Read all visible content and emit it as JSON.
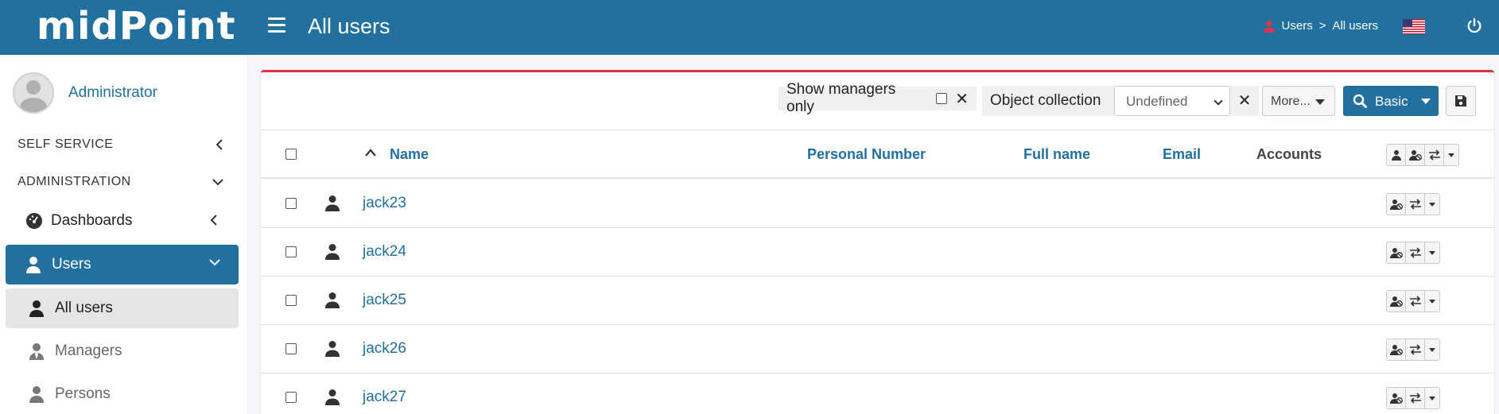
{
  "header": {
    "logo_text": "midPoint",
    "page_title": "All users",
    "breadcrumbs": [
      "Users",
      ">",
      "All users"
    ]
  },
  "sidebar": {
    "profile_name": "Administrator",
    "sections": [
      {
        "label": "SELF SERVICE"
      },
      {
        "label": "ADMINISTRATION"
      }
    ],
    "items": [
      {
        "label": "Dashboards"
      },
      {
        "label": "Users"
      },
      {
        "label": "All users"
      },
      {
        "label": "Managers"
      },
      {
        "label": "Persons"
      }
    ]
  },
  "toolbar": {
    "show_managers_label": "Show managers only",
    "object_collection_label": "Object collection",
    "object_collection_value": "Undefined",
    "more_label": "More...",
    "basic_label": "Basic"
  },
  "table": {
    "columns": [
      "Name",
      "Personal Number",
      "Full name",
      "Email",
      "Accounts"
    ],
    "rows": [
      {
        "name": "jack23"
      },
      {
        "name": "jack24"
      },
      {
        "name": "jack25"
      },
      {
        "name": "jack26"
      },
      {
        "name": "jack27"
      }
    ]
  },
  "colors": {
    "brand": "#22709f",
    "accent_border": "#dc3545"
  }
}
